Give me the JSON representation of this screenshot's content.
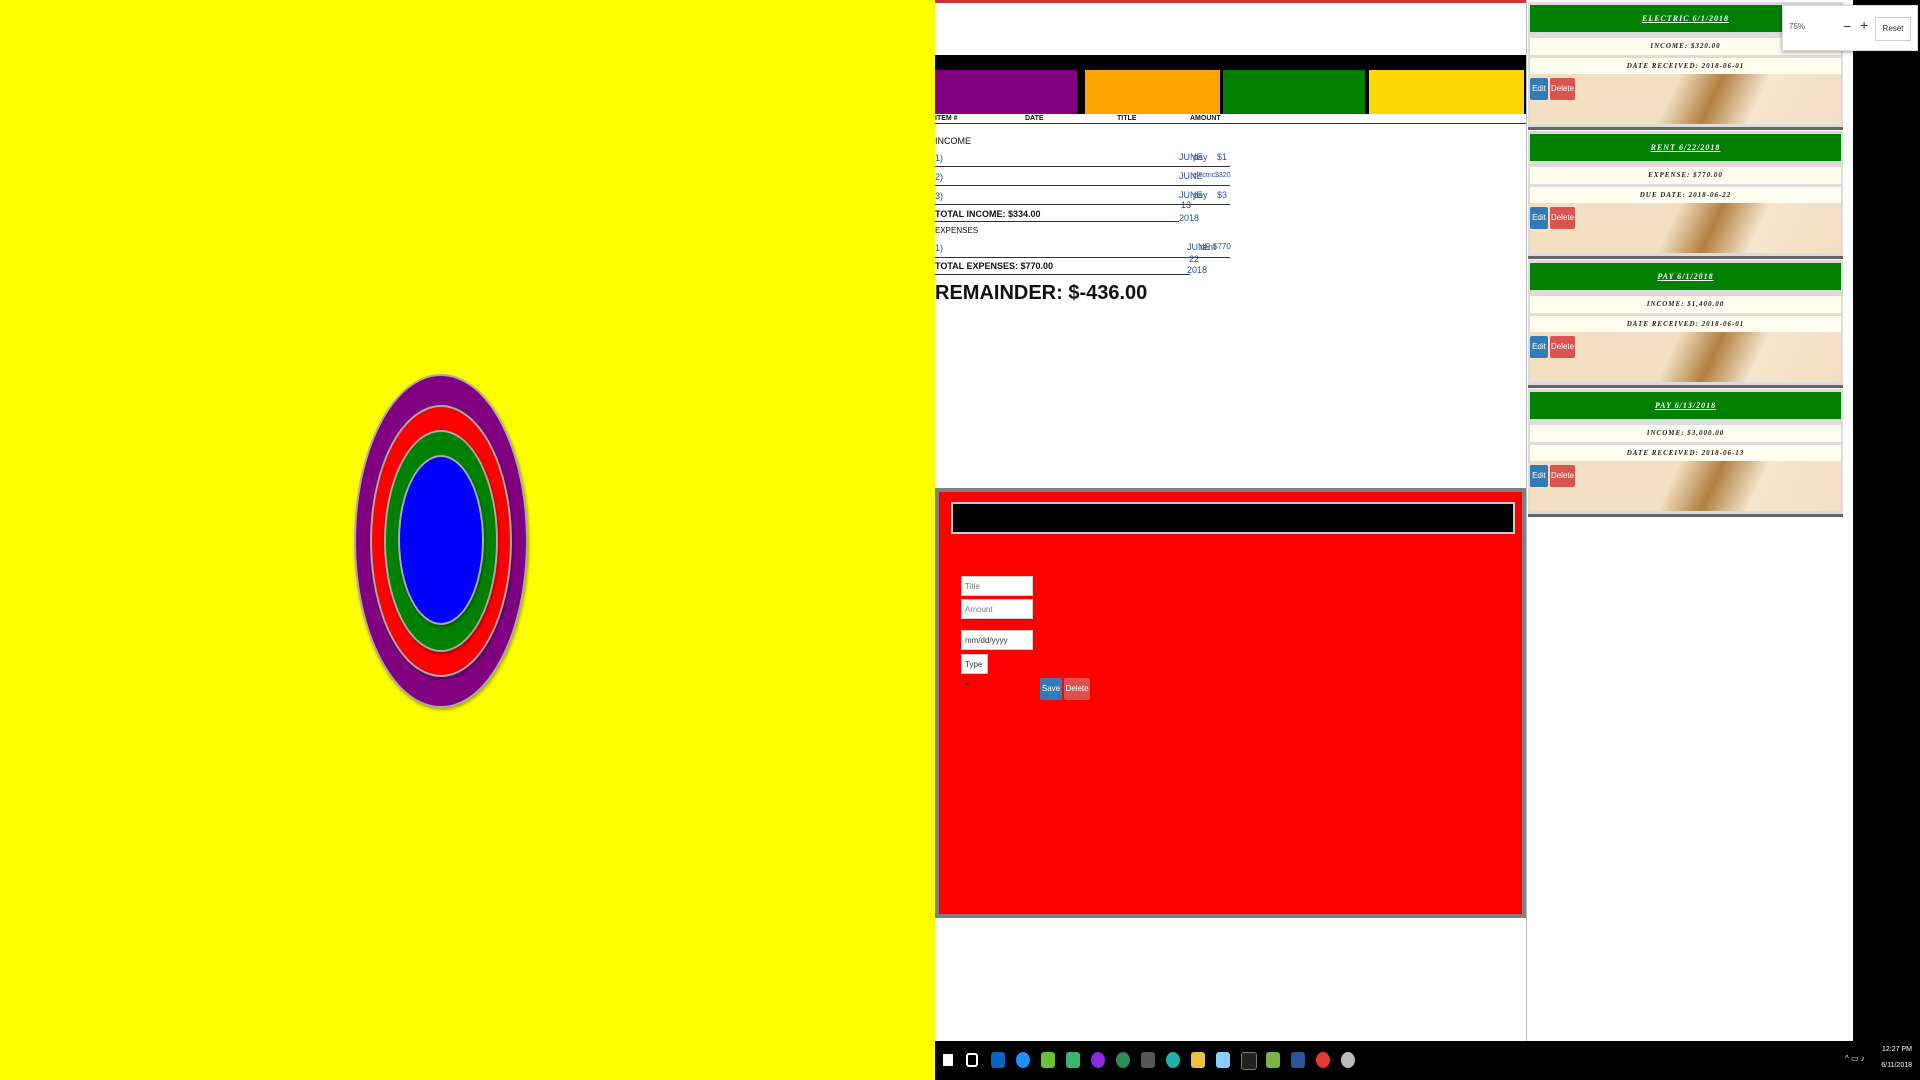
{
  "table": {
    "headers": [
      "ITEM #",
      "DATE",
      "TITLE",
      "AMOUNT"
    ],
    "income_label": "INCOME",
    "income_rows": [
      {
        "num": "1)",
        "date": "JUNE",
        "title": "pay",
        "amount": "$1"
      },
      {
        "num": "2)",
        "date": "JUNE",
        "title": "electric",
        "amount": "$320"
      },
      {
        "num": "3)",
        "date": "JUNE",
        "title": "pay",
        "amount": "$3"
      }
    ],
    "income_overflow": [
      "13",
      "2018"
    ],
    "total_income": "TOTAL INCOME: $334.00",
    "expenses_label": "EXPENSES",
    "expense_rows": [
      {
        "num": "1)",
        "date": "JUNE",
        "title": "rent",
        "amount": "$770"
      }
    ],
    "expense_overflow": [
      "22",
      "2018"
    ],
    "total_expenses": "TOTAL EXPENSES: $770.00",
    "remainder": "REMAINDER: $-436.00"
  },
  "form": {
    "title_placeholder": "Title",
    "amount_placeholder": "Amount",
    "date_value": "mm/dd/yyyy",
    "type_label": "Type ▾",
    "save_label": "Save",
    "delete_label": "Delete"
  },
  "cards": [
    {
      "title": "ELECTRIC 6/1/2018",
      "line1": "INCOME: $320.00",
      "line2": "DATE RECEIVED: 2018-06-01",
      "edit": "Edit",
      "delete": "Delete"
    },
    {
      "title": "RENT 6/22/2018",
      "line1": "EXPENSE: $770.00",
      "line2": "DUE DATE: 2018-06-22",
      "edit": "Edit",
      "delete": "Delete"
    },
    {
      "title": "PAY 6/1/2018",
      "line1": "INCOME: $1,400.00",
      "line2": "DATE RECEIVED: 2018-06-01",
      "edit": "Edit",
      "delete": "Delete"
    },
    {
      "title": "PAY 6/13/2018",
      "line1": "INCOME: $3,000.00",
      "line2": "DATE RECEIVED: 2018-06-13",
      "edit": "Edit",
      "delete": "Delete"
    }
  ],
  "zoom": {
    "level": "75%",
    "minus": "−",
    "plus": "+",
    "reset": "Reset"
  },
  "tray": {
    "time": "12:27 PM",
    "date": "6/11/2018"
  },
  "colors": {
    "left_bg": "#ffff00",
    "ring_outer": "#800080",
    "ring_2": "#ff0000",
    "ring_3": "#008000",
    "ring_inner": "#0000ff",
    "cat_purple": "#800080",
    "cat_orange": "#ffa500",
    "cat_green": "#008000",
    "cat_gold": "#ffd700",
    "form_bg": "#ff0000",
    "card_header": "#008000",
    "edit_btn": "#337ab7",
    "delete_btn": "#d9534f"
  },
  "taskbar_icons": [
    "windows-start-icon",
    "task-view-icon",
    "outlook-icon",
    "edge-icon",
    "maps-icon",
    "app-icon",
    "app-icon",
    "chrome-dev-icon",
    "calculator-icon",
    "app-icon",
    "file-explorer-icon",
    "notepad-icon",
    "terminal-icon",
    "notepad-plus-icon",
    "word-icon",
    "chrome-icon",
    "app-icon"
  ]
}
